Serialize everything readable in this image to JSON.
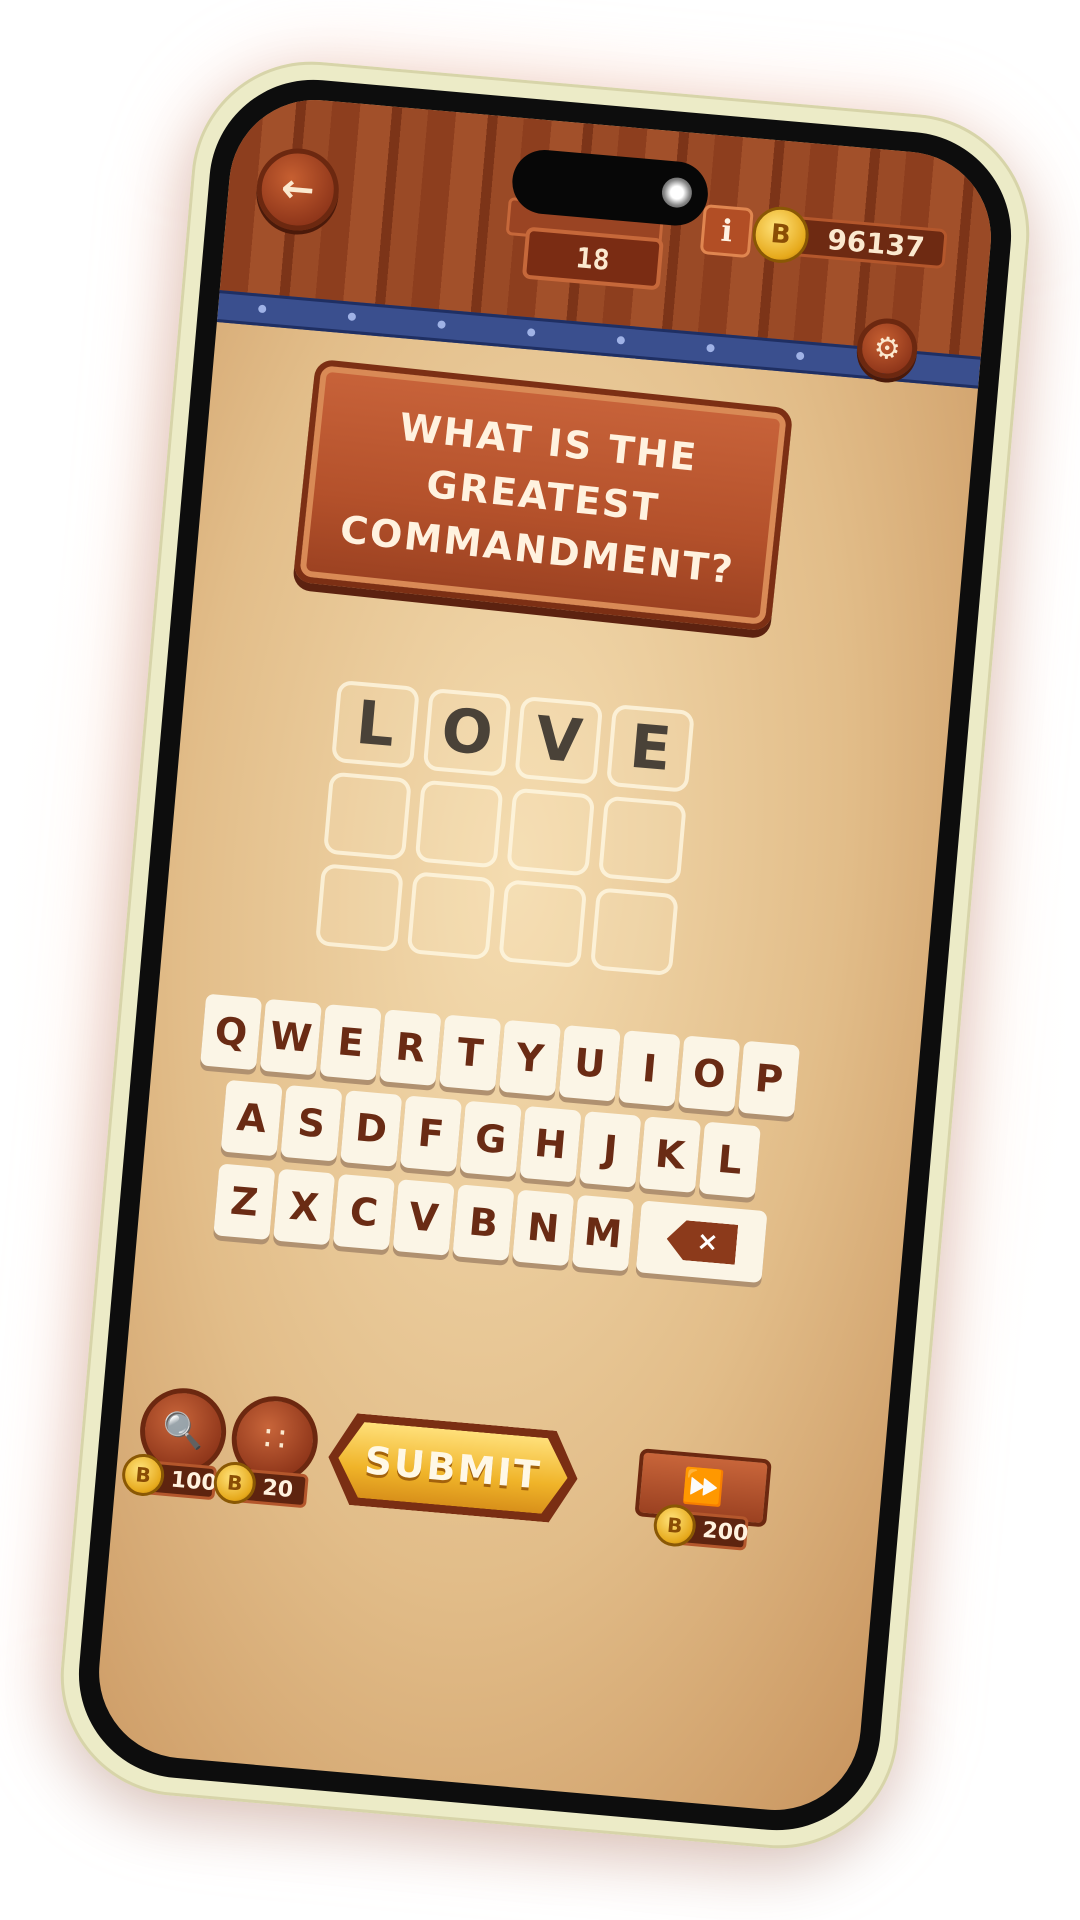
{
  "header": {
    "back_icon": "arrow-left-icon",
    "score_value": "18",
    "info_label": "i",
    "coin_symbol": "B",
    "coins": "96137",
    "settings_icon": "gear-icon"
  },
  "question": {
    "lines": [
      "WHAT IS THE",
      "GREATEST",
      "COMMANDMENT?"
    ]
  },
  "answer": {
    "letters": [
      "L",
      "O",
      "V",
      "E",
      "",
      "",
      "",
      "",
      "",
      "",
      "",
      ""
    ]
  },
  "keyboard": {
    "row1": [
      "Q",
      "W",
      "E",
      "R",
      "T",
      "Y",
      "U",
      "I",
      "O",
      "P"
    ],
    "row2": [
      "A",
      "S",
      "D",
      "F",
      "G",
      "H",
      "J",
      "K",
      "L"
    ],
    "row3": [
      "Z",
      "X",
      "C",
      "V",
      "B",
      "N",
      "M"
    ],
    "backspace": "×"
  },
  "powerups": {
    "hint_cost": "100",
    "reveal_cost": "20",
    "skip_cost": "200"
  },
  "submit_label": "SUBMIT",
  "colors": {
    "wood": "#a2502a",
    "rail": "#3a4f8e",
    "parchment": "#e2bd89",
    "gold": "#f0b429",
    "key_text": "#6a2b14"
  }
}
